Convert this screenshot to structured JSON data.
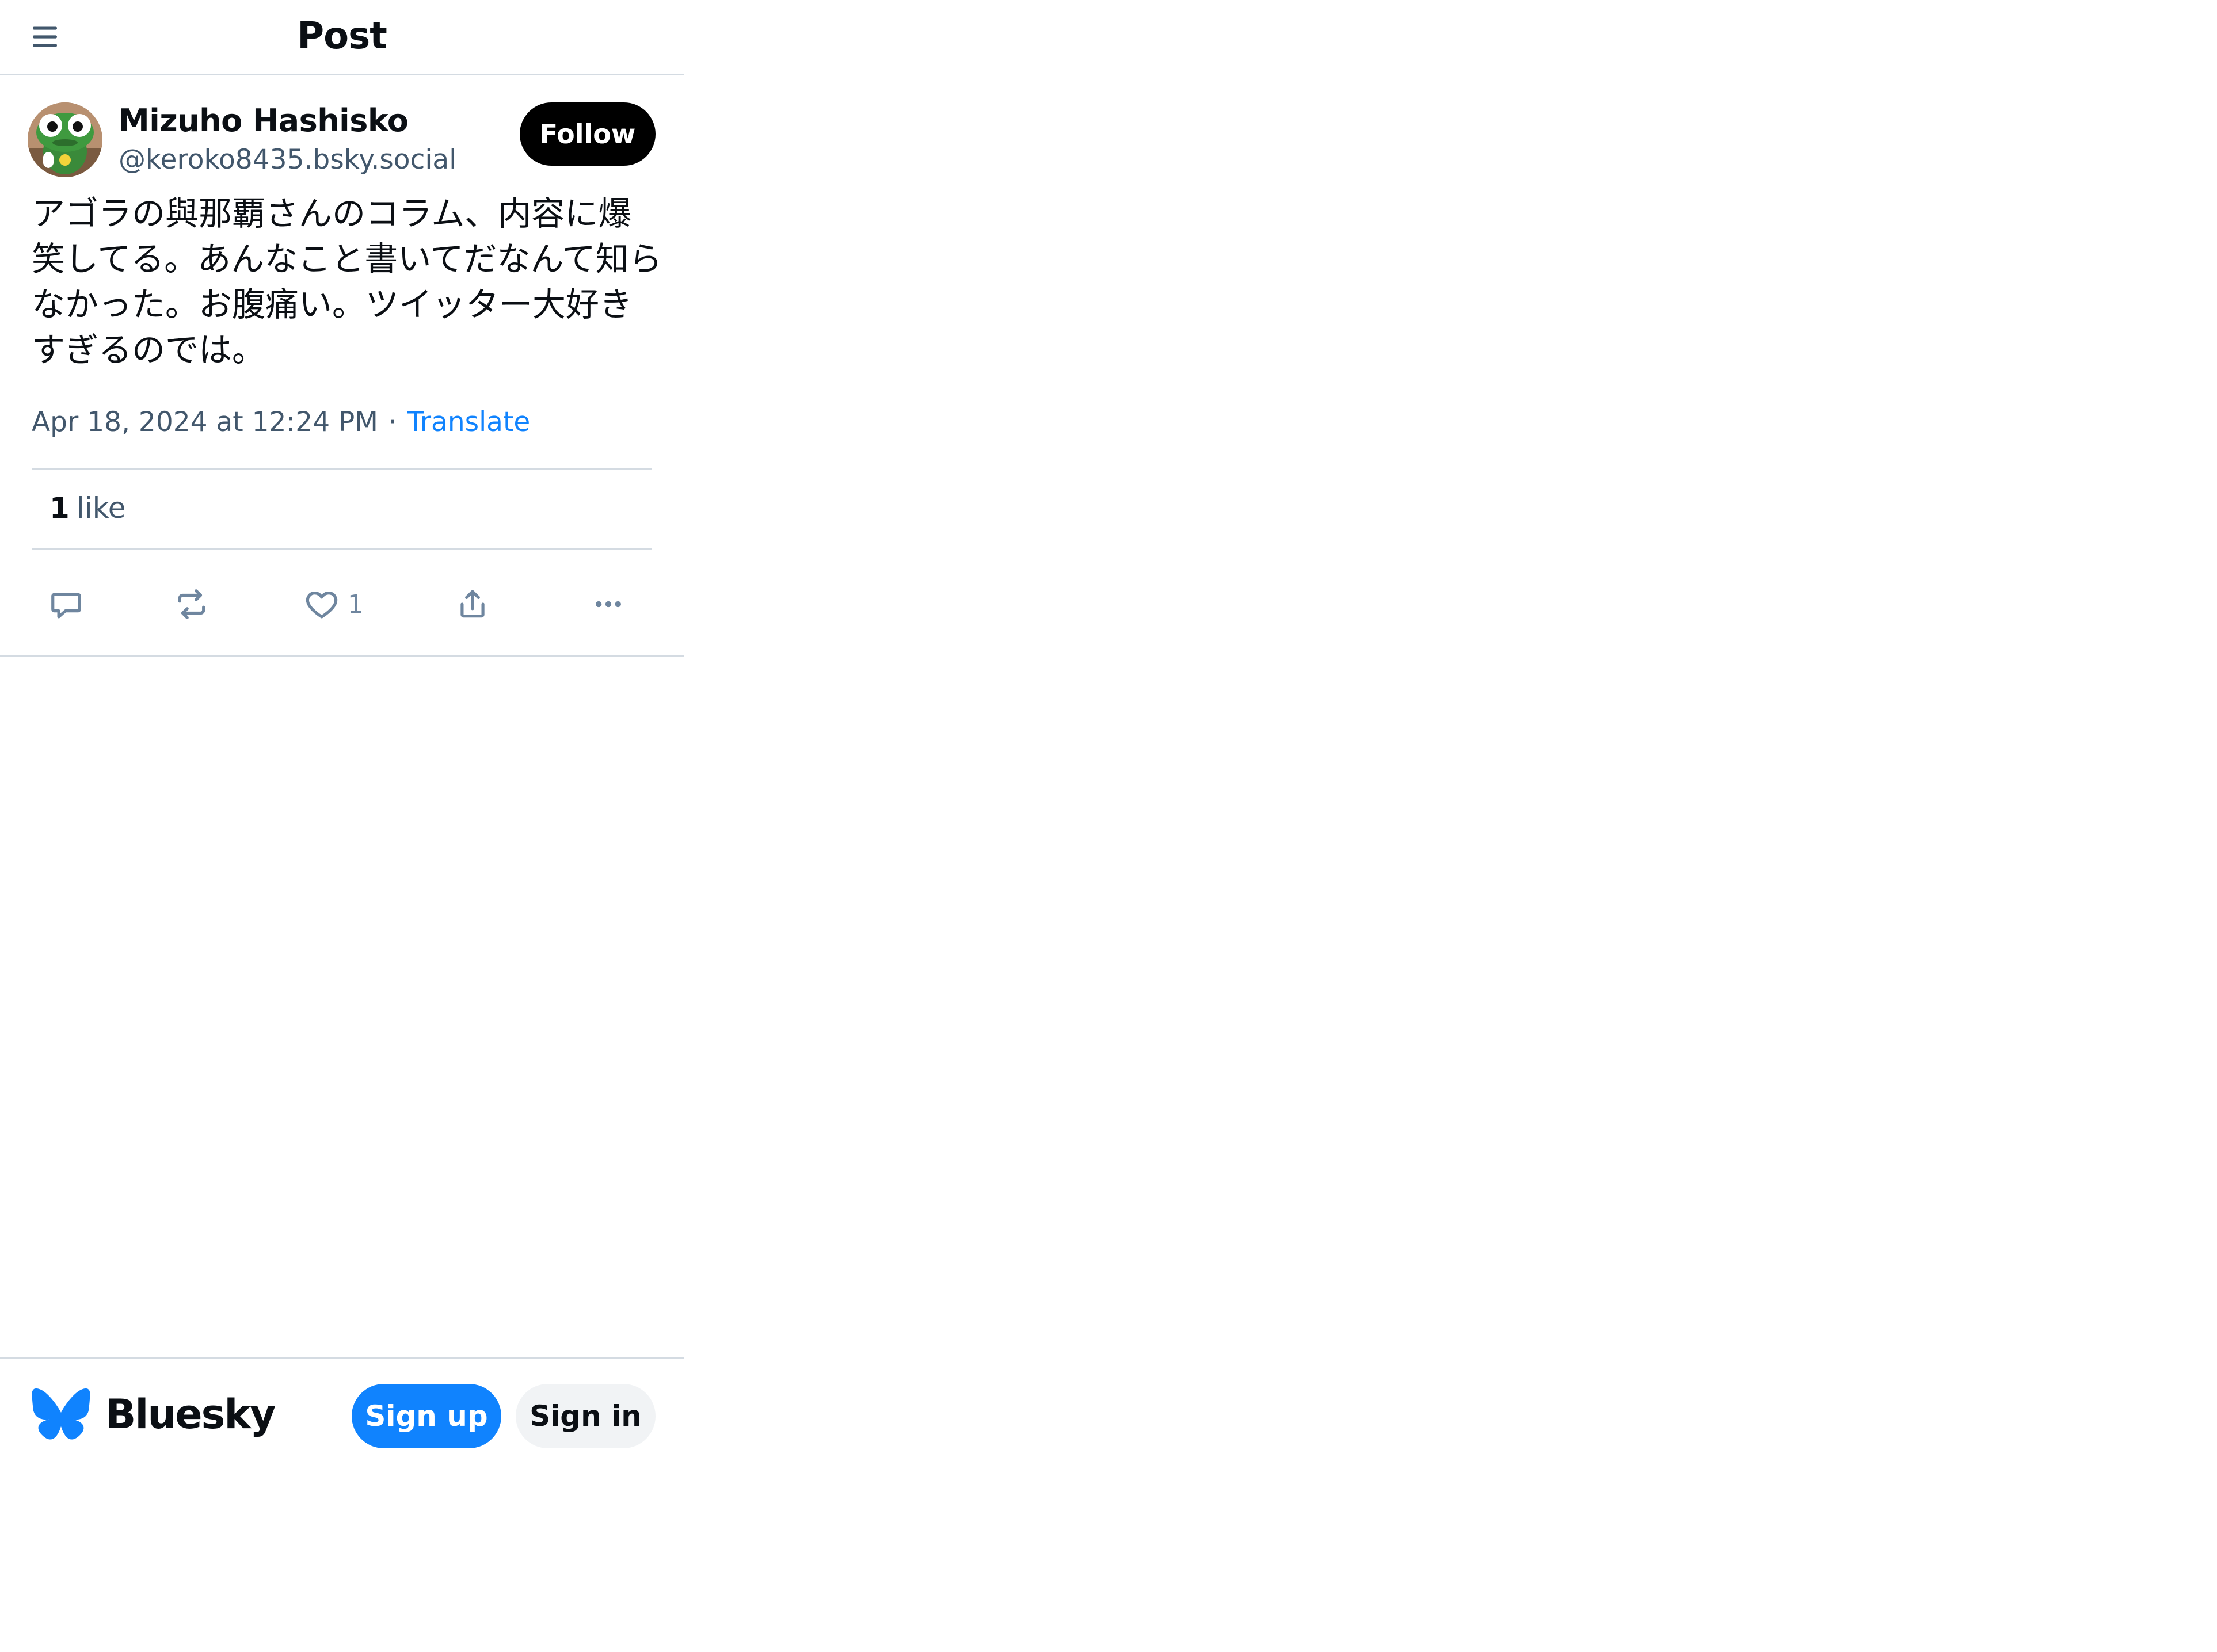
{
  "header": {
    "title": "Post",
    "menu_icon": "hamburger-menu-icon"
  },
  "post": {
    "author": {
      "display_name": "Mizuho Hashisko",
      "handle": "@keroko8435.bsky.social",
      "avatar_icon": "frog-character-avatar"
    },
    "follow_label": "Follow",
    "text": "アゴラの與那覇さんのコラム、内容に爆笑してる。あんなこと書いてだなんて知らなかった。お腹痛い。ツイッター大好きすぎるのでは。",
    "timestamp": "Apr 18, 2024 at 12:24 PM",
    "separator": "·",
    "translate_label": "Translate",
    "like_count": "1",
    "like_word": "like",
    "actions": {
      "reply_icon": "reply-icon",
      "repost_icon": "repost-icon",
      "like_icon": "heart-icon",
      "like_count": "1",
      "share_icon": "share-icon",
      "more_icon": "more-icon"
    }
  },
  "footer": {
    "brand_name": "Bluesky",
    "brand_icon": "butterfly-logo-icon",
    "signup_label": "Sign up",
    "signin_label": "Sign in"
  },
  "colors": {
    "accent": "#1083fe",
    "text": "#0b0f14",
    "muted": "#42576c",
    "icon": "#6f869f",
    "border": "#d4dbe2"
  }
}
